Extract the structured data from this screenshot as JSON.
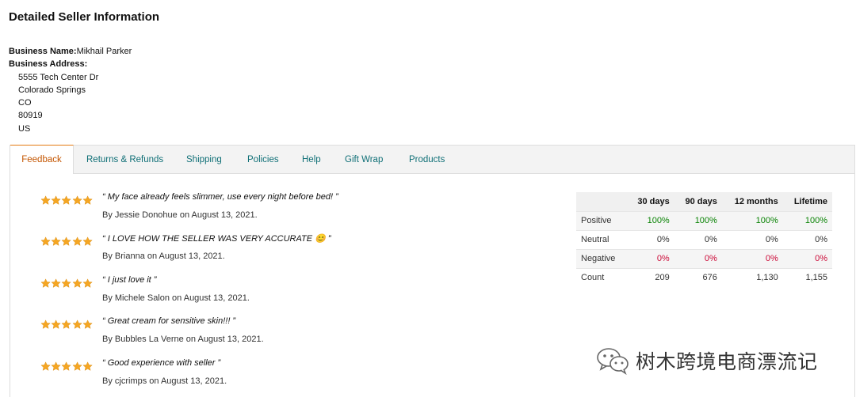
{
  "page_title": "Detailed Seller Information",
  "business": {
    "name_label": "Business Name:",
    "name": "Mikhail Parker",
    "address_label": "Business Address:",
    "address_lines": [
      "5555 Tech Center Dr",
      "Colorado Springs",
      "CO",
      "80919",
      "US"
    ]
  },
  "tabs": [
    {
      "label": "Feedback",
      "active": true
    },
    {
      "label": "Returns & Refunds",
      "active": false
    },
    {
      "label": "Shipping",
      "active": false
    },
    {
      "label": "Policies",
      "active": false
    },
    {
      "label": "Help",
      "active": false
    },
    {
      "label": "Gift Wrap",
      "active": false
    },
    {
      "label": "Products",
      "active": false
    }
  ],
  "reviews": [
    {
      "rating": 5,
      "quote": "“ My face already feels slimmer, use every night before bed! ”",
      "byline": "By Jessie Donohue on August 13, 2021."
    },
    {
      "rating": 5,
      "quote": "“ I LOVE HOW THE SELLER WAS VERY ACCURATE 😊 ”",
      "byline": "By Brianna on August 13, 2021."
    },
    {
      "rating": 5,
      "quote": "“ I just love it ”",
      "byline": "By Michele Salon on August 13, 2021."
    },
    {
      "rating": 5,
      "quote": "“ Great cream for sensitive skin!!! ”",
      "byline": "By Bubbles La Verne on August 13, 2021."
    },
    {
      "rating": 5,
      "quote": "“ Good experience with seller ”",
      "byline": "By cjcrimps on August 13, 2021."
    }
  ],
  "feedback_table": {
    "headers": [
      "",
      "30 days",
      "90 days",
      "12 months",
      "Lifetime"
    ],
    "rows": [
      {
        "label": "Positive",
        "values": [
          "100%",
          "100%",
          "100%",
          "100%"
        ],
        "color": "#098304"
      },
      {
        "label": "Neutral",
        "values": [
          "0%",
          "0%",
          "0%",
          "0%"
        ],
        "color": "#333333"
      },
      {
        "label": "Negative",
        "values": [
          "0%",
          "0%",
          "0%",
          "0%"
        ],
        "color": "#cc0c39"
      },
      {
        "label": "Count",
        "values": [
          "209",
          "676",
          "1,130",
          "1,155"
        ],
        "color": "#333333"
      }
    ]
  },
  "watermark": {
    "text": "树木跨境电商漂流记",
    "icon": "wechat-icon"
  },
  "colors": {
    "star": "#f5a623",
    "link": "#0f6f76",
    "active_tab": "#c45500"
  }
}
